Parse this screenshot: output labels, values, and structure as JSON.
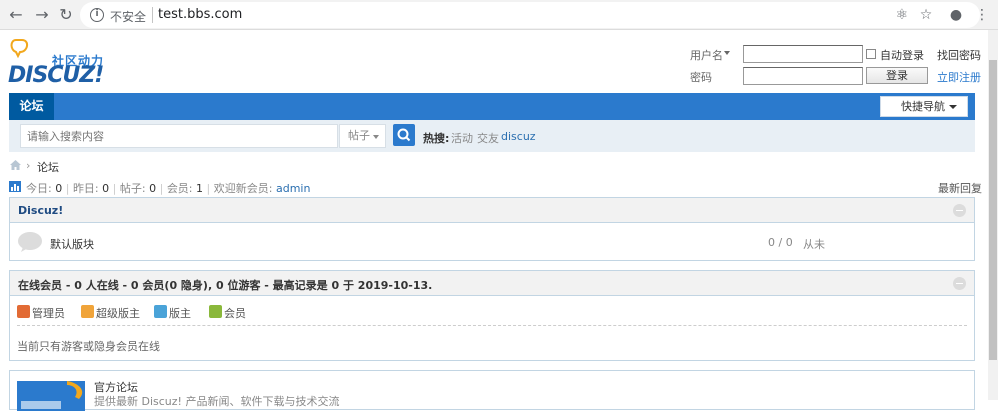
{
  "browser": {
    "back_icon": "back-arrow-icon",
    "forward_icon": "forward-arrow-icon",
    "reload_icon": "reload-icon",
    "security_text": "不安全",
    "url": "test.bbs.com"
  },
  "header": {
    "logo_tagline": "社区动力",
    "logo_text": "DISCUZ!",
    "username_label": "用户名",
    "password_label": "密码",
    "auto_login_label": "自动登录",
    "forgot_password": "找回密码",
    "login_button": "登录",
    "register_link": "立即注册"
  },
  "nav": {
    "forum_tab": "论坛",
    "quick_nav": "快捷导航"
  },
  "search": {
    "placeholder": "请输入搜索内容",
    "type": "帖子",
    "hot_label": "热搜:",
    "hot_terms": [
      "活动",
      "交友",
      "discuz"
    ]
  },
  "breadcrumb": {
    "current": "论坛"
  },
  "stats": {
    "today_label": "今日:",
    "today": "0",
    "yesterday_label": "昨日:",
    "yesterday": "0",
    "posts_label": "帖子:",
    "posts": "0",
    "members_label": "会员:",
    "members": "1",
    "newest_label": "欢迎新会员:",
    "newest_member": "admin",
    "latest_reply": "最新回复"
  },
  "category": {
    "title": "Discuz!",
    "forum_name": "默认版块",
    "counts": "0 / 0",
    "last_post": "从未"
  },
  "online": {
    "summary_prefix": "在线会员",
    "summary": "在线会员 - 0 人在线 - 0 会员(0 隐身), 0 位游客 - 最高记录是 0 于 2019-10-13.",
    "roles": [
      "管理员",
      "超级版主",
      "版主",
      "会员"
    ],
    "role_colors": [
      "#e26b35",
      "#f0a43a",
      "#4aa3d8",
      "#8ab83b"
    ],
    "empty_text": "当前只有游客或隐身会员在线"
  },
  "links": {
    "official_title": "官方论坛",
    "official_desc": "提供最新 Discuz! 产品新闻、软件下载与技术交流"
  }
}
